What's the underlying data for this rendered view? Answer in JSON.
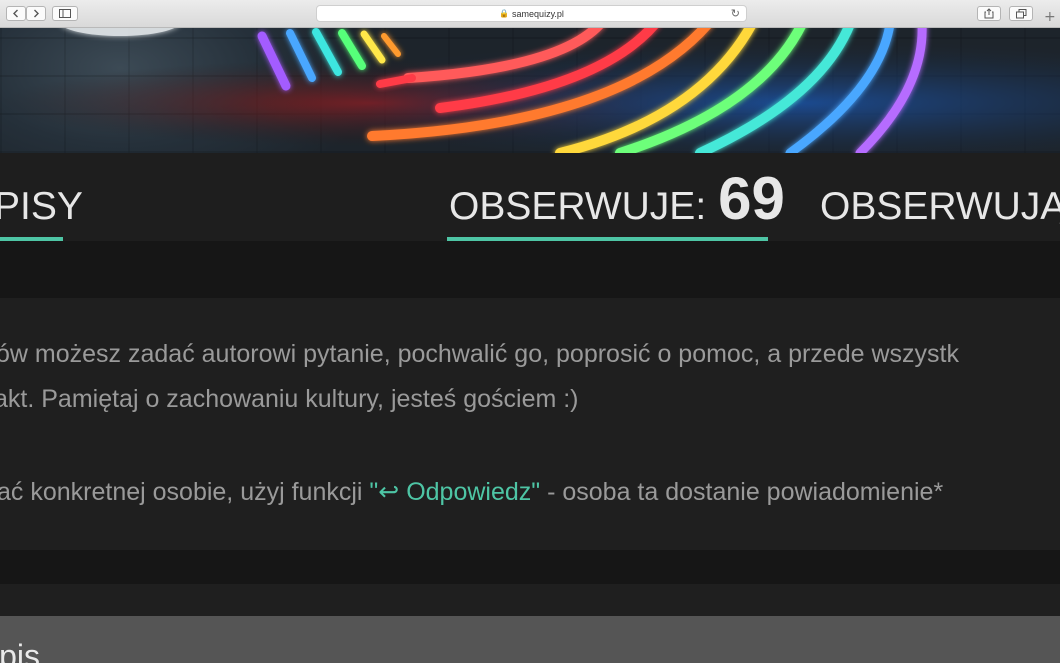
{
  "browser": {
    "url": "samequizy.pl",
    "back_icon": "chevron-left-icon",
    "forward_icon": "chevron-right-icon",
    "sidebar_icon": "sidebar-icon",
    "share_icon": "share-icon",
    "tabs_icon": "tabs-overview-icon",
    "new_tab": "+"
  },
  "banner": {
    "description": ""
  },
  "profile_tabs": {
    "posts_label": "PISY",
    "following_label": "OBSERWUJE:",
    "following_count": "69",
    "followers_label": "OBSERWUJĄC",
    "active_underline_color": "#4ec5a5"
  },
  "info": {
    "line1": "ów możesz zadać autorowi pytanie, pochwalić go, poprosić o pomoc, a przede wszystk",
    "line2": "akt. Pamiętaj o zachowaniu kultury, jesteś gościem :)",
    "line3_before": "ać konkretnej osobie, użyj funkcji ",
    "line3_link": "\"↩ Odpowiedz\"",
    "line3_after": " - osoba ta dostanie powiadomienie*"
  },
  "new_post": {
    "label": "wpis"
  }
}
